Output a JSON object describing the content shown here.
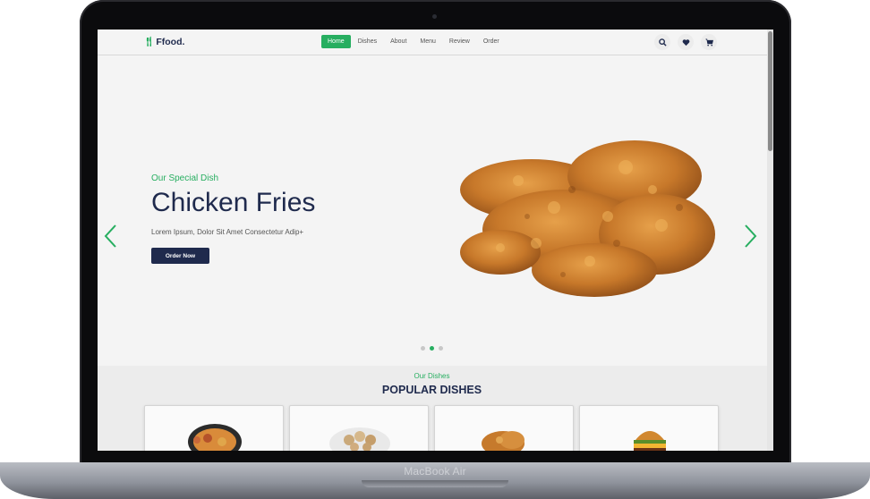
{
  "device": {
    "label": "MacBook Air"
  },
  "nav": {
    "logo": "Ffood.",
    "links": [
      "Home",
      "Dishes",
      "About",
      "Menu",
      "Review",
      "Order"
    ],
    "icons": [
      "search-icon",
      "heart-icon",
      "cart-icon"
    ]
  },
  "hero": {
    "subtitle": "Our Special Dish",
    "title": "Chicken Fries",
    "description": "Lorem Ipsum, Dolor Sit Amet Consectetur Adip+",
    "button": "Order Now",
    "slide_count": 3,
    "active_slide": 2
  },
  "section": {
    "subtitle": "Our Dishes",
    "title": "POPULAR DISHES"
  },
  "colors": {
    "accent": "#27ae60",
    "navy": "#1f2a4d"
  }
}
